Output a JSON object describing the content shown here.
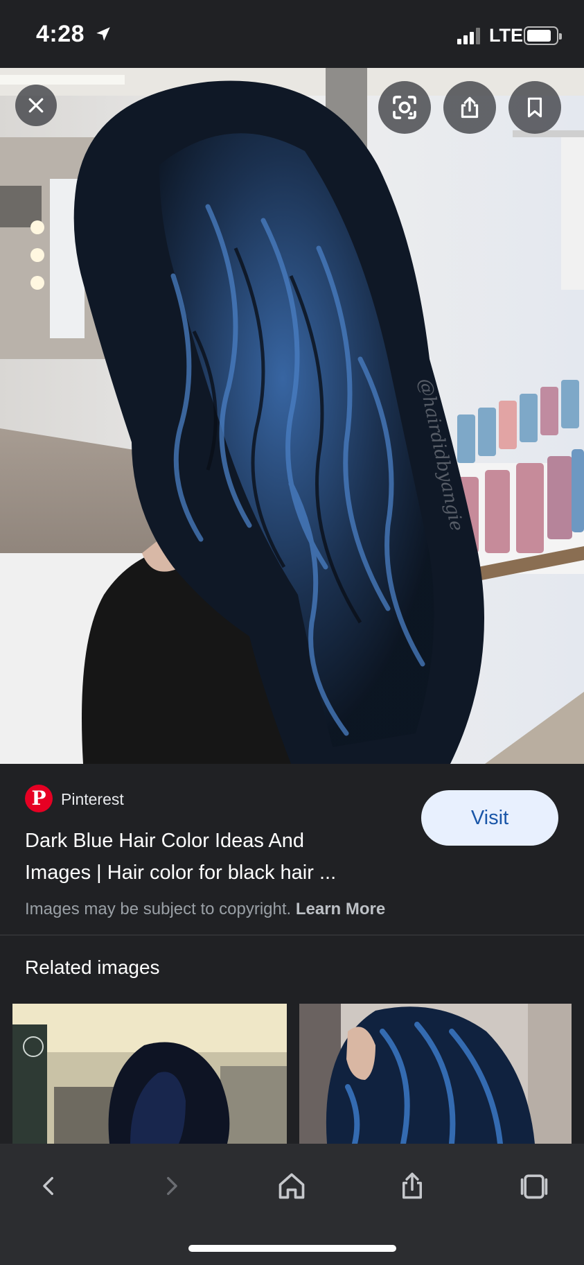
{
  "status_bar": {
    "time": "4:28",
    "network": "LTE",
    "location_icon": "location-arrow-icon",
    "signal_icon": "cellular-signal-icon",
    "battery_icon": "battery-icon"
  },
  "viewer": {
    "close_icon": "close-icon",
    "lens_icon": "lens-search-icon",
    "share_icon": "share-icon",
    "bookmark_icon": "bookmark-icon",
    "image_watermark": "@hairdidbyangie"
  },
  "result": {
    "source_name": "Pinterest",
    "source_logo_letter": "P",
    "title_line1": "Dark Blue Hair Color Ideas And",
    "title_line2": "Images | Hair color for black hair ...",
    "visit_label": "Visit",
    "copyright_text": "Images may be subject to copyright.",
    "learn_more_label": "Learn More"
  },
  "related": {
    "heading": "Related images"
  },
  "toolbar": {
    "back_icon": "chevron-left-icon",
    "forward_icon": "chevron-right-icon",
    "home_icon": "home-icon",
    "share_icon": "share-icon",
    "tabs_icon": "tabs-icon"
  },
  "colors": {
    "background": "#202124",
    "toolbar": "#2c2d30",
    "visit_bg": "#e8f0fe",
    "visit_text": "#1a56a8",
    "pinterest_red": "#e60023",
    "hair_blue": "#2f5f9e"
  }
}
